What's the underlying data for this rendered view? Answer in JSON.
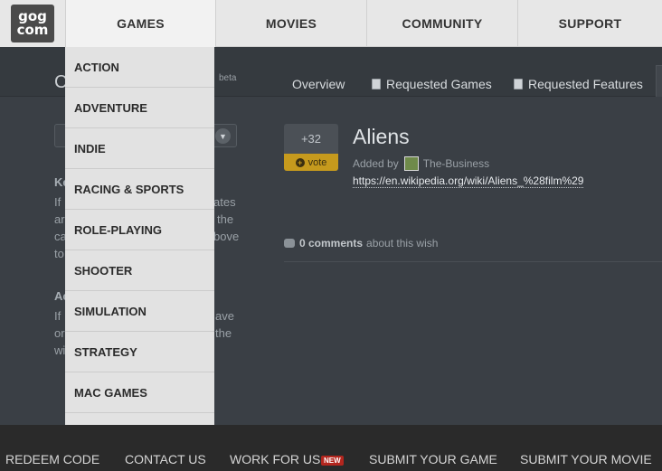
{
  "logo": {
    "line1": "gog",
    "line2": "com"
  },
  "nav": {
    "games": "GAMES",
    "movies": "MOVIES",
    "community": "COMMUNITY",
    "support": "SUPPORT"
  },
  "header": {
    "title_fragment": "C",
    "beta": "beta"
  },
  "tabs": {
    "overview": "Overview",
    "requested_games": "Requested Games",
    "requested_features": "Requested Features"
  },
  "left_panel": {
    "heading1_fragment": "Ke",
    "frag_a": "If",
    "frag_b": "ates",
    "frag_c": "ar",
    "frag_d": "the",
    "frag_e": "ca",
    "frag_f": "bove",
    "frag_g": "to",
    "heading2_fragment": "Ac",
    "frag_h": "If",
    "frag_i": "ave",
    "frag_j": "or",
    "frag_k": "the",
    "frag_l": "wi"
  },
  "wish": {
    "votes": "+32",
    "vote_label": "vote",
    "title": "Aliens",
    "added_by_label": "Added by",
    "author": "The-Business",
    "link": "https://en.wikipedia.org/wiki/Aliens_%28film%29",
    "comments_count": "0 comments",
    "comments_suffix": "about this wish"
  },
  "dropdown": {
    "items": [
      "ACTION",
      "ADVENTURE",
      "INDIE",
      "RACING & SPORTS",
      "ROLE-PLAYING",
      "SHOOTER",
      "SIMULATION",
      "STRATEGY",
      "MAC GAMES"
    ]
  },
  "footer": {
    "redeem": "REDEEM CODE",
    "contact": "CONTACT US",
    "work": "WORK FOR US",
    "new_badge": "NEW",
    "submit_game": "SUBMIT YOUR GAME",
    "submit_movie": "SUBMIT YOUR MOVIE"
  }
}
